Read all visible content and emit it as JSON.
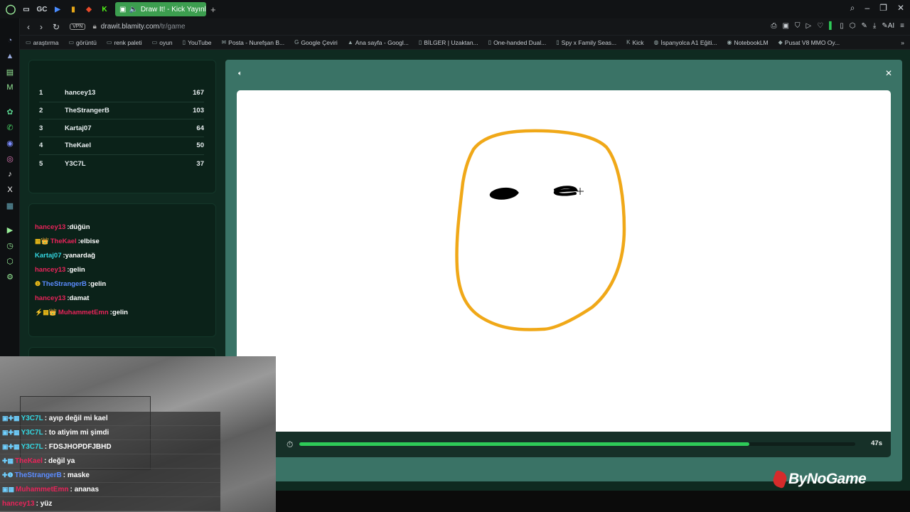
{
  "browser": {
    "tab_title": "Draw It! - Kick Yayınları",
    "url_host": "drawit.blamity.com",
    "url_path": "/tr/game",
    "vpn": "VPN",
    "ai_label": "AI"
  },
  "pinned_tabs": [
    "GC"
  ],
  "bookmarks": [
    {
      "label": "araştırma",
      "icon": "folder-icon"
    },
    {
      "label": "görüntü",
      "icon": "folder-icon"
    },
    {
      "label": "renk paleti",
      "icon": "folder-icon"
    },
    {
      "label": "oyun",
      "icon": "folder-icon"
    },
    {
      "label": "YouTube",
      "icon": "page-icon"
    },
    {
      "label": "Posta - Nurefşan B...",
      "icon": "mail-icon"
    },
    {
      "label": "Google Çeviri",
      "icon": "translate-icon"
    },
    {
      "label": "Ana sayfa - Googl...",
      "icon": "drive-icon"
    },
    {
      "label": "BİLGER | Uzaktan...",
      "icon": "page-icon"
    },
    {
      "label": "One-handed Dual...",
      "icon": "page-icon"
    },
    {
      "label": "Spy x Family Seas...",
      "icon": "page-icon"
    },
    {
      "label": "Kick",
      "icon": "kick-icon"
    },
    {
      "label": "İspanyolca A1 Eğiti...",
      "icon": "globe-icon"
    },
    {
      "label": "NotebookLM",
      "icon": "notebook-icon"
    },
    {
      "label": "Pusat V8 MMO Oy...",
      "icon": "game-icon"
    }
  ],
  "leaderboard": [
    {
      "rank": "1",
      "name": "hancey13",
      "score": "167"
    },
    {
      "rank": "2",
      "name": "TheStrangerB",
      "score": "103"
    },
    {
      "rank": "3",
      "name": "Kartaj07",
      "score": "64"
    },
    {
      "rank": "4",
      "name": "TheKael",
      "score": "50"
    },
    {
      "rank": "5",
      "name": "Y3C7L",
      "score": "37"
    }
  ],
  "game_chat": [
    {
      "user": "hancey13",
      "text": ":düğün",
      "color": "#e8245a",
      "badges": ""
    },
    {
      "user": "TheKael",
      "text": ":elbise",
      "color": "#e8245a",
      "badges": "▦👑"
    },
    {
      "user": "Kartaj07",
      "text": ":yanardağ",
      "color": "#33d6e0",
      "badges": ""
    },
    {
      "user": "hancey13",
      "text": ":gelin",
      "color": "#e8245a",
      "badges": ""
    },
    {
      "user": "TheStrangerB",
      "text": ":gelin",
      "color": "#5b8cff",
      "badges": "❶"
    },
    {
      "user": "hancey13",
      "text": ":damat",
      "color": "#e8245a",
      "badges": ""
    },
    {
      "user": "MuhammetEmn",
      "text": ":gelin",
      "color": "#e8245a",
      "badges": "⚡▦👑"
    }
  ],
  "game": {
    "time_left": "47s",
    "progress": 0.81
  },
  "stream_chat": [
    {
      "user": "Y3C7L",
      "text": " : ayıp değil mi kael",
      "color": "#33d6e0",
      "badges": "▣✚▦"
    },
    {
      "user": "Y3C7L",
      "text": " : to atiyim mi şimdi",
      "color": "#33d6e0",
      "badges": "▣✚▦"
    },
    {
      "user": "Y3C7L",
      "text": " : FDSJHOPDFJBHD",
      "color": "#33d6e0",
      "badges": "▣✚▦"
    },
    {
      "user": "TheKael",
      "text": " : değil ya",
      "color": "#e8245a",
      "badges": "✚▦"
    },
    {
      "user": "TheStrangerB",
      "text": " : maske",
      "color": "#5b8cff",
      "badges": "✚❶"
    },
    {
      "user": "MuhammetEmn",
      "text": " : ananas",
      "color": "#e8245a",
      "badges": "▣▦"
    },
    {
      "user": "hancey13",
      "text": " : yüz",
      "color": "#e8245a",
      "badges": ""
    }
  ],
  "watermark": "ByNoGame",
  "colors": {
    "accent": "#2ecb58",
    "panel": "#0b2219",
    "drawing_stroke": "#f0a818"
  }
}
